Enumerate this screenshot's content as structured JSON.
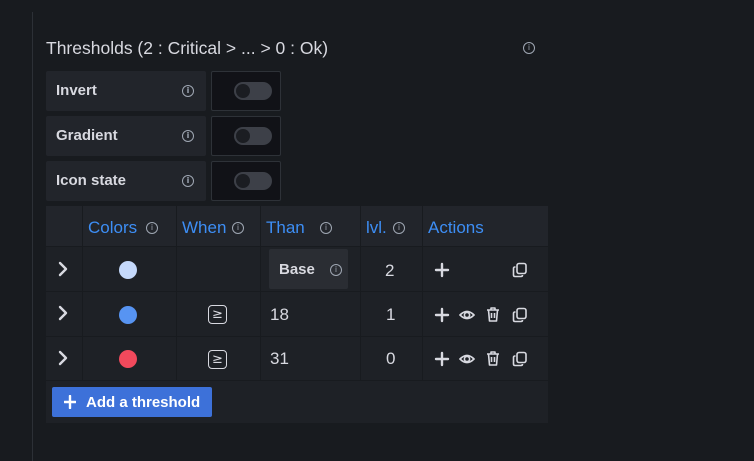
{
  "section": {
    "title": "Thresholds (2 : Critical > ... > 0 : Ok)",
    "info_glyph": "i"
  },
  "options": [
    {
      "label": "Invert",
      "enabled": false
    },
    {
      "label": "Gradient",
      "enabled": false
    },
    {
      "label": "Icon state",
      "enabled": false
    }
  ],
  "table": {
    "headers": {
      "colors": "Colors",
      "when": "When",
      "than": "Than",
      "level": "lvl.",
      "actions": "Actions"
    },
    "rows": [
      {
        "color": "#c5d9fb",
        "operator": "",
        "than": "Base",
        "level": "2"
      },
      {
        "color": "#5794f2",
        "operator": "≥",
        "than": "18",
        "level": "1"
      },
      {
        "color": "#f2495c",
        "operator": "≥",
        "than": "31",
        "level": "0"
      }
    ]
  },
  "add_button": {
    "label": "Add a threshold",
    "icon": "plus-icon"
  },
  "colors": {
    "accent": "#3d8ef5",
    "button": "#3d71d9",
    "background": "#181b1f"
  },
  "icons": {
    "chevron": "chevron-right-icon",
    "add": "plus-icon",
    "visibility": "eye-icon",
    "delete": "trash-icon",
    "duplicate": "copy-icon"
  }
}
